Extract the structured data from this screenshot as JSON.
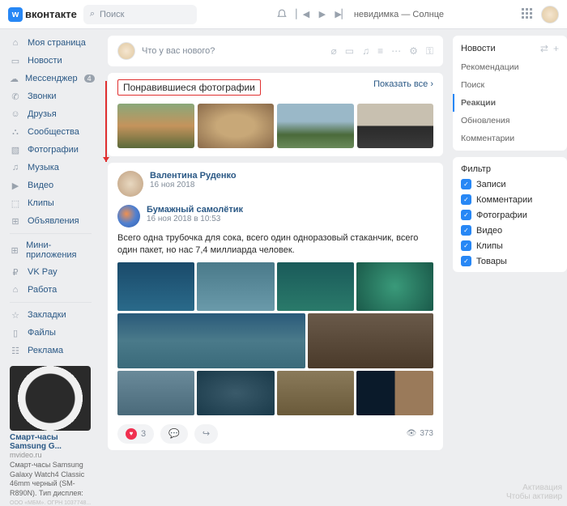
{
  "header": {
    "brand": "вконтакте",
    "search_placeholder": "Поиск",
    "track": "невидимка — Солнце"
  },
  "nav": {
    "items": [
      {
        "icon": "⌂",
        "label": "Моя страница"
      },
      {
        "icon": "▭",
        "label": "Новости"
      },
      {
        "icon": "☁",
        "label": "Мессенджер",
        "badge": "4"
      },
      {
        "icon": "✆",
        "label": "Звонки"
      },
      {
        "icon": "☺",
        "label": "Друзья"
      },
      {
        "icon": "⛬",
        "label": "Сообщества"
      },
      {
        "icon": "▧",
        "label": "Фотографии"
      },
      {
        "icon": "♫",
        "label": "Музыка"
      },
      {
        "icon": "▶",
        "label": "Видео"
      },
      {
        "icon": "⬚",
        "label": "Клипы"
      },
      {
        "icon": "⊞",
        "label": "Объявления"
      }
    ],
    "sep1": [
      {
        "icon": "⊞",
        "label": "Мини-приложения"
      },
      {
        "icon": "₽",
        "label": "VK Pay"
      },
      {
        "icon": "⌂",
        "label": "Работа"
      }
    ],
    "sep2": [
      {
        "icon": "☆",
        "label": "Закладки"
      },
      {
        "icon": "▯",
        "label": "Файлы"
      },
      {
        "icon": "☷",
        "label": "Реклама"
      }
    ]
  },
  "ad": {
    "title": "Смарт-часы Samsung G...",
    "domain": "mvideo.ru",
    "desc": "Смарт-часы Samsung Galaxy Watch4 Classic 46mm черный (SM-R890N). Тип дисплея:",
    "legal": "ООО «МБМ». ОГРН 1037748..."
  },
  "composer": {
    "placeholder": "Что у вас нового?"
  },
  "liked": {
    "title": "Понравившиеся фотографии",
    "show_all": "Показать все"
  },
  "post": {
    "author": "Валентина Руденко",
    "date": "16 ноя 2018",
    "repost_author": "Бумажный самолётик",
    "repost_date": "16 ноя 2018 в 10:53",
    "text": "Всего одна трубочка для сока, всего один одноразовый стаканчик, всего один пакет, но нас 7,4 миллиарда человек.",
    "likes": "3",
    "views": "373"
  },
  "rside": {
    "news": "Новости",
    "tabs": [
      "Рекомендации",
      "Поиск",
      "Реакции",
      "Обновления",
      "Комментарии"
    ],
    "filter_title": "Фильтр",
    "filters": [
      "Записи",
      "Комментарии",
      "Фотографии",
      "Видео",
      "Клипы",
      "Товары"
    ]
  },
  "watermark": {
    "l1": "Активация",
    "l2": "Чтобы активир"
  }
}
